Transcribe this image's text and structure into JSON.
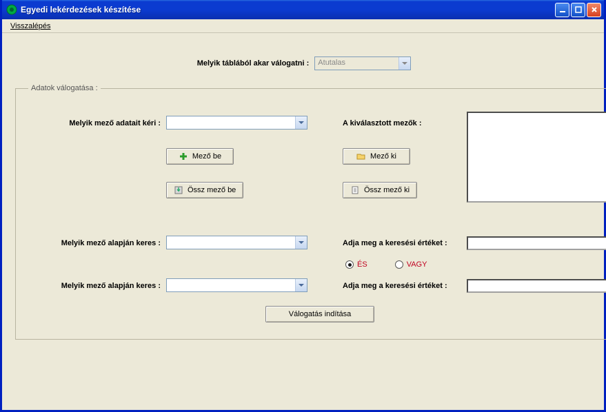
{
  "window": {
    "title": "Egyedi lekérdezések készítése"
  },
  "menu": {
    "back": "Visszalépés"
  },
  "top": {
    "table_label": "Melyik táblából akar válogatni :",
    "table_value": "Atutalas"
  },
  "group": {
    "legend": "Adatok válogatása :",
    "field_request_label": "Melyik mező adatait kéri :",
    "field_request_value": "",
    "btn_field_in": "Mező be",
    "btn_all_in": "Össz mező be",
    "selected_label": "A kiválasztott mezők :",
    "btn_field_out": "Mező ki",
    "btn_all_out": "Össz mező ki",
    "search1_label": "Melyik mező alapján keres :",
    "search1_value": "",
    "searchval1_label": "Adja meg a keresési értéket :",
    "searchval1_value": "",
    "radio_and": "ÉS",
    "radio_or": "VAGY",
    "radio_selected": "and",
    "search2_label": "Melyik mező alapján keres :",
    "search2_value": "",
    "searchval2_label": "Adja meg a keresési értéket :",
    "searchval2_value": "",
    "btn_start": "Válogatás indítása"
  }
}
